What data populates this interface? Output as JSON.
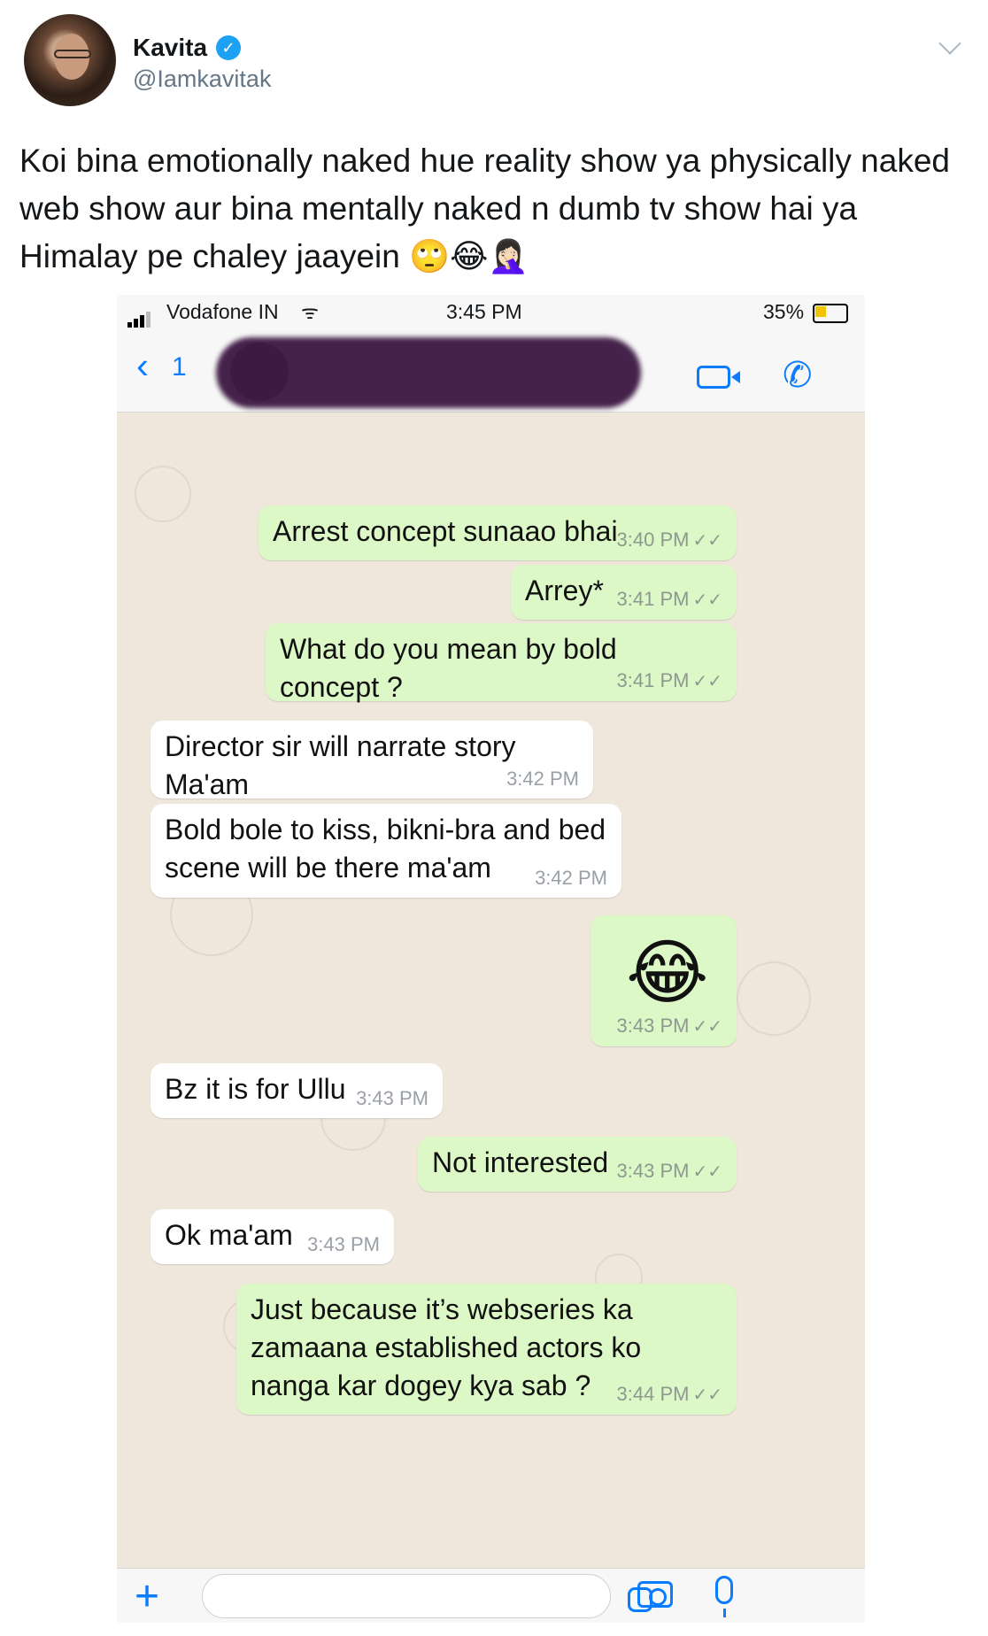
{
  "tweet": {
    "display_name": "Kavita",
    "verified_glyph": "✓",
    "handle": "@Iamkavitak",
    "text": "Koi bina emotionally naked hue reality show ya physically naked web show aur bina mentally naked n dumb tv show hai ya Himalay pe chaley jaayein 🙄😂🤦🏻‍♀️"
  },
  "status_bar": {
    "carrier": "Vodafone IN",
    "wifi_glyph": "ᯤ",
    "time": "3:45 PM",
    "battery": "35%"
  },
  "chat_header": {
    "back_glyph": "‹",
    "back_count": "1",
    "phone_glyph": "✆"
  },
  "messages": [
    {
      "dir": "out",
      "text": "Arrest concept sunaao bhai",
      "time": "3:40 PM"
    },
    {
      "dir": "out",
      "text": "Arrey*",
      "time": "3:41 PM"
    },
    {
      "dir": "out",
      "text": "What do you mean by bold concept ?",
      "time": "3:41 PM"
    },
    {
      "dir": "in",
      "text": "Director sir will narrate story Ma'am",
      "time": "3:42 PM"
    },
    {
      "dir": "in",
      "text": "Bold bole to kiss, bikni-bra and bed scene will be there ma'am",
      "time": "3:42 PM"
    },
    {
      "dir": "out",
      "text": "😂",
      "time": "3:43 PM"
    },
    {
      "dir": "in",
      "text": "Bz it is for Ullu",
      "time": "3:43 PM"
    },
    {
      "dir": "out",
      "text": "Not interested",
      "time": "3:43 PM"
    },
    {
      "dir": "in",
      "text": "Ok ma'am",
      "time": "3:43 PM"
    },
    {
      "dir": "out",
      "text": "Just because it’s webseries ka zamaana established actors ko nanga kar dogey kya sab ?",
      "time": "3:44 PM"
    }
  ],
  "read_tick": "✓✓",
  "input_bar": {
    "plus_glyph": "+"
  },
  "colors": {
    "outgoing": "#dcf8c6",
    "incoming": "#ffffff",
    "accent": "#0a7cff",
    "chat_bg": "#efe7dc",
    "verified": "#1da1f2"
  }
}
